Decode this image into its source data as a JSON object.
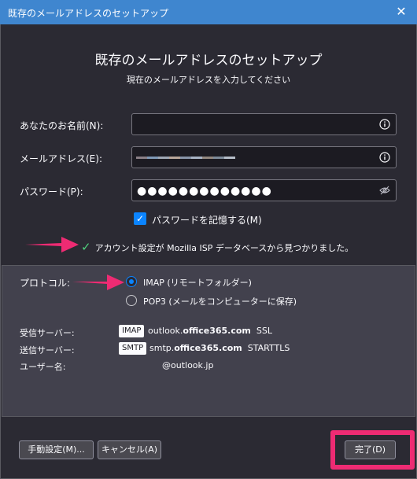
{
  "window": {
    "title": "既存のメールアドレスのセットアップ",
    "close_glyph": "✕"
  },
  "header": {
    "title": "既存のメールアドレスのセットアップ",
    "subtitle": "現在のメールアドレスを入力してください"
  },
  "form": {
    "name_label": "あなたのお名前(N):",
    "email_label": "メールアドレス(E):",
    "password_label": "パスワード(P):",
    "password_value": "●●●●●●●●●●●●●",
    "remember_label": "パスワードを記憶する(M)",
    "remember_checked": true
  },
  "status": {
    "check_glyph": "✓",
    "message": "アカウント設定が Mozilla ISP データベースから見つかりました。"
  },
  "protocol": {
    "label": "プロトコル:",
    "options": [
      {
        "label": "IMAP (リモートフォルダー)",
        "selected": true
      },
      {
        "label": "POP3 (メールをコンピューターに保存)",
        "selected": false
      }
    ]
  },
  "servers": {
    "incoming_label": "受信サーバー:",
    "incoming_tag": "IMAP",
    "incoming_host_prefix": "outlook.",
    "incoming_host_bold": "office365.com",
    "incoming_security": "SSL",
    "outgoing_label": "送信サーバー:",
    "outgoing_tag": "SMTP",
    "outgoing_host_prefix": "smtp.",
    "outgoing_host_bold": "office365.com",
    "outgoing_security": "STARTTLS",
    "username_label": "ユーザー名:",
    "username_value": "@outlook.jp"
  },
  "buttons": {
    "manual": "手動設定(M)...",
    "cancel": "キャンセル(A)",
    "done": "完了(D)"
  },
  "colors": {
    "titlebar": "#3f86cf",
    "accent": "#0b84ff",
    "highlight": "#ee2b73",
    "background": "#2b2a33"
  }
}
